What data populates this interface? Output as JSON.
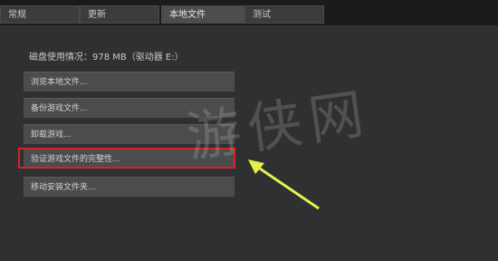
{
  "tabs": [
    {
      "label": "常规"
    },
    {
      "label": "更新"
    },
    {
      "label": "本地文件"
    },
    {
      "label": "测试"
    }
  ],
  "disk_usage": "磁盘使用情况：978 MB（驱动器 E:）",
  "buttons": [
    {
      "label": "浏览本地文件..."
    },
    {
      "label": "备份游戏文件..."
    },
    {
      "label": "卸载游戏..."
    },
    {
      "label": "验证游戏文件的完整性..."
    },
    {
      "label": "移动安装文件夹..."
    }
  ],
  "watermark": "游侠网",
  "colors": {
    "highlight": "#d8212a",
    "arrow": "#e6f24a"
  }
}
